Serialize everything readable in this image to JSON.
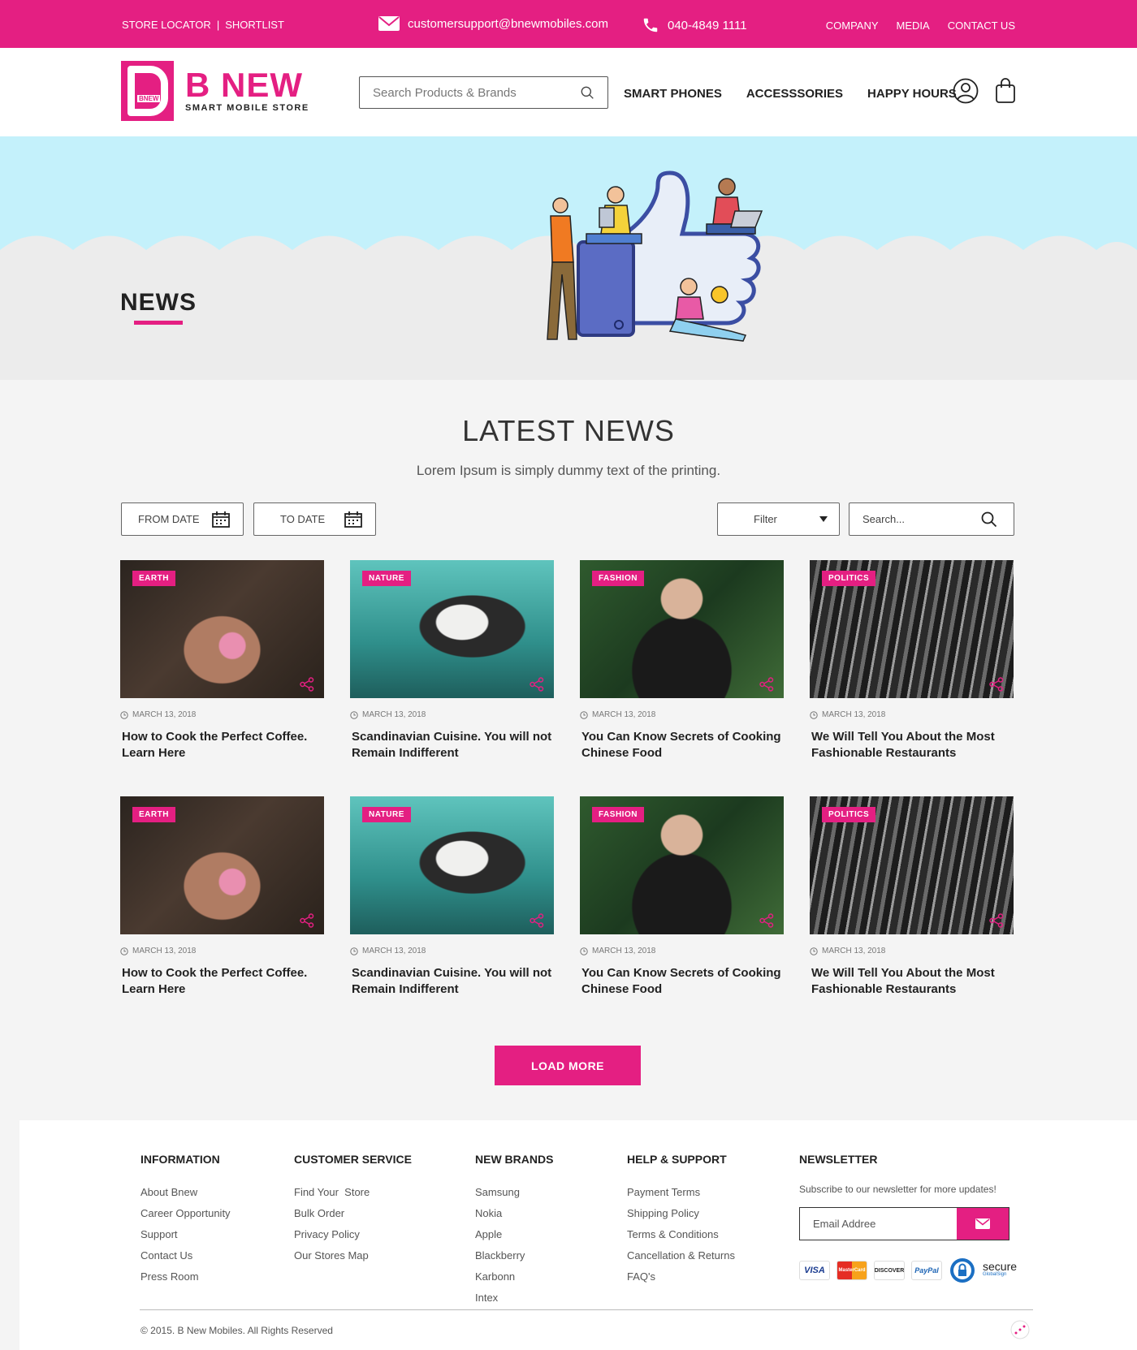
{
  "topbar": {
    "store_locator": "STORE LOCATOR",
    "divider": "|",
    "shortlist": "SHORTLIST",
    "email": "customersupport@bnewmobiles.com",
    "phone": "040-4849 1111",
    "links": [
      "COMPANY",
      "MEDIA",
      "CONTACT US"
    ]
  },
  "header": {
    "logo_mark_text": "BNEW",
    "brand": "B NEW",
    "tagline": "SMART MOBILE STORE",
    "search_placeholder": "Search Products & Brands",
    "nav": [
      "SMART PHONES",
      "ACCESSSORIES",
      "HAPPY HOURS"
    ]
  },
  "hero": {
    "title": "NEWS"
  },
  "latest": {
    "title": "LATEST NEWS",
    "subtitle": "Lorem Ipsum is simply dummy text of the printing."
  },
  "filters": {
    "from_date": "FROM DATE",
    "to_date": "TO DATE",
    "filter": "Filter",
    "search_placeholder": "Search..."
  },
  "articles": [
    {
      "category": "EARTH",
      "date": "MARCH 13, 2018",
      "title": "How to Cook the Perfect Coffee. Learn Here"
    },
    {
      "category": "NATURE",
      "date": "MARCH 13, 2018",
      "title": "Scandinavian Cuisine. You will not Remain Indifferent"
    },
    {
      "category": "FASHION",
      "date": "MARCH 13, 2018",
      "title": "You Can Know Secrets of Cooking Chinese Food"
    },
    {
      "category": "POLITICS",
      "date": "MARCH 13, 2018",
      "title": "We Will Tell You About the Most Fashionable Restaurants"
    },
    {
      "category": "EARTH",
      "date": "MARCH 13, 2018",
      "title": "How to Cook the Perfect Coffee. Learn Here"
    },
    {
      "category": "NATURE",
      "date": "MARCH 13, 2018",
      "title": "Scandinavian Cuisine. You will not Remain Indifferent"
    },
    {
      "category": "FASHION",
      "date": "MARCH 13, 2018",
      "title": "You Can Know Secrets of Cooking Chinese Food"
    },
    {
      "category": "POLITICS",
      "date": "MARCH 13, 2018",
      "title": "We Will Tell You About the Most Fashionable Restaurants"
    }
  ],
  "load_more": "LOAD MORE",
  "footer": {
    "information": {
      "title": "INFORMATION",
      "items": [
        "About Bnew",
        "Career Opportunity",
        "Support",
        "Contact Us",
        "Press Room"
      ]
    },
    "customer_service": {
      "title": "CUSTOMER SERVICE",
      "items": [
        "Find Your  Store",
        "Bulk Order",
        "Privacy Policy",
        "Our Stores Map"
      ]
    },
    "new_brands": {
      "title": "NEW BRANDS",
      "items": [
        "Samsung",
        "Nokia",
        "Apple",
        "Blackberry",
        "Karbonn",
        "Intex"
      ]
    },
    "help_support": {
      "title": "HELP & SUPPORT",
      "items": [
        "Payment Terms",
        "Shipping Policy",
        "Terms & Conditions",
        "Cancellation & Returns",
        "FAQ's"
      ]
    },
    "newsletter": {
      "title": "NEWSLETTER",
      "text": "Subscribe to our newsletter for more updates!",
      "email_placeholder": "Email Addree",
      "payment": [
        "VISA",
        "MasterCard",
        "DISCOVER",
        "PayPal"
      ],
      "secure": "secure",
      "secure_sub": "GlobalSign"
    },
    "copyright": "© 2015. B New Mobiles. All Rights Reserved"
  },
  "colors": {
    "brand": "#e41f82",
    "sky": "#c4f1fb"
  }
}
